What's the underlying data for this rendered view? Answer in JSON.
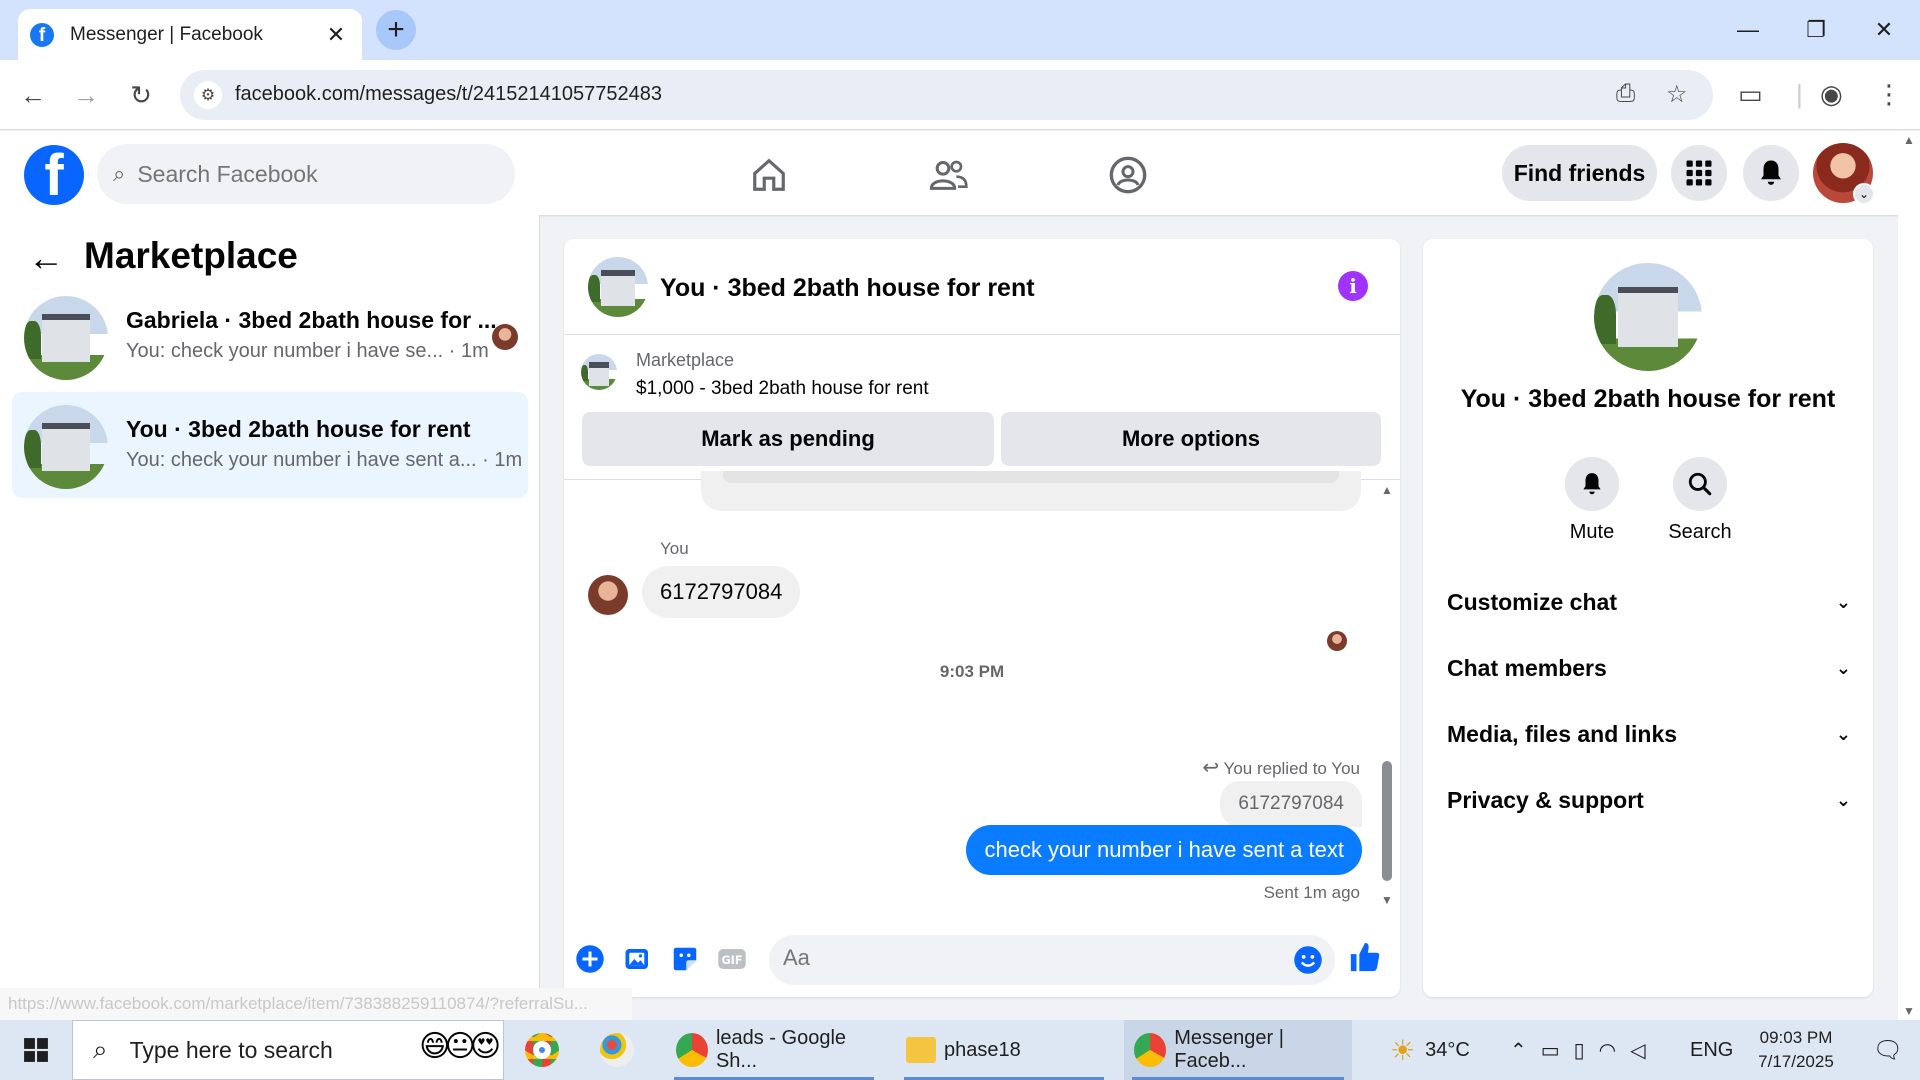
{
  "browser": {
    "tab_title": "Messenger | Facebook",
    "url": "facebook.com/messages/t/24152141057752483",
    "status_url": "https://www.facebook.com/marketplace/item/738388259110874/?referralSu..."
  },
  "fb_header": {
    "search_placeholder": "Search Facebook",
    "find_friends_label": "Find friends"
  },
  "sidebar": {
    "title": "Marketplace",
    "conversations": [
      {
        "name": "Gabriela · 3bed 2bath house for ...",
        "preview": "You: check your number i have se...",
        "time": "· 1m",
        "active": false
      },
      {
        "name": "You · 3bed 2bath house for rent",
        "preview": "You: check your number i have sent a...",
        "time": "· 1m",
        "active": true
      }
    ]
  },
  "chat": {
    "title": "You · 3bed 2bath house for rent",
    "listing": {
      "category": "Marketplace",
      "price_title": "$1,000 - 3bed 2bath house for rent",
      "mark_pending_label": "Mark as pending",
      "more_options_label": "More options"
    },
    "messages": {
      "sender_label": "You",
      "incoming_text": "6172797084",
      "timestamp": "9:03 PM",
      "replied_label": "You replied to You",
      "quoted_text": "6172797084",
      "outgoing_text": "check your number i have sent a text",
      "sent_status": "Sent 1m ago"
    },
    "composer_placeholder": "Aa"
  },
  "info_panel": {
    "title": "You · 3bed 2bath house for rent",
    "actions": [
      {
        "label": "Mute",
        "icon": "bell-icon"
      },
      {
        "label": "Search",
        "icon": "search-icon"
      }
    ],
    "sections": [
      "Customize chat",
      "Chat members",
      "Media, files and links",
      "Privacy & support"
    ]
  },
  "taskbar": {
    "search_placeholder": "Type here to search",
    "apps": [
      {
        "label": "",
        "icon": "chrome-icon"
      },
      {
        "label": "",
        "icon": "paint-icon"
      },
      {
        "label": "leads - Google Sh...",
        "icon": "chrome-icon"
      },
      {
        "label": "phase18",
        "icon": "folder-icon"
      },
      {
        "label": "Messenger | Faceb...",
        "icon": "chrome-icon"
      }
    ],
    "weather": "34°C",
    "language": "ENG",
    "time": "09:03 PM",
    "date": "7/17/2025"
  },
  "colors": {
    "fb_blue": "#0866ff",
    "messenger_blue": "#0a7cff",
    "info_purple": "#a033ff",
    "active_conv_bg": "#ebf5ff"
  }
}
